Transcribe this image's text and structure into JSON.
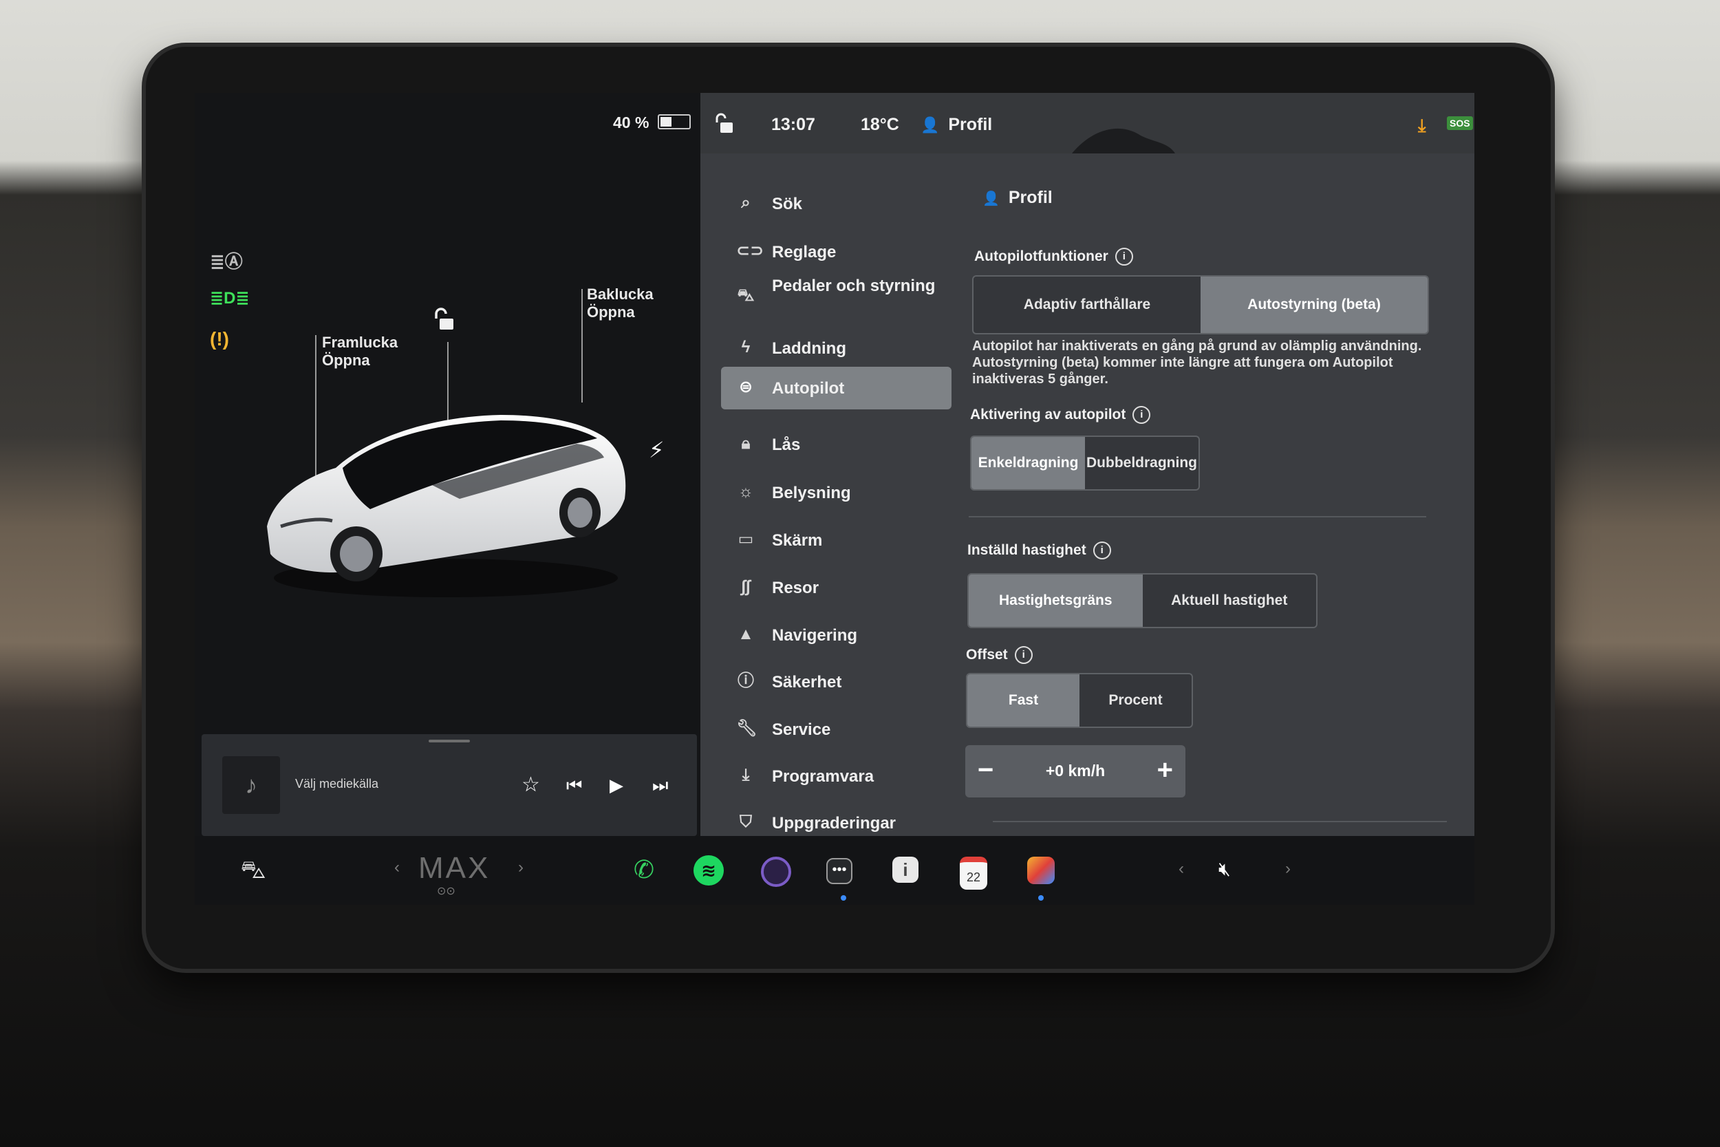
{
  "status": {
    "battery": "40 %",
    "time": "13:07",
    "temperature": "18°C",
    "profile": "Profil"
  },
  "car_view": {
    "frunk_label": "Framlucka",
    "frunk_action": "Öppna",
    "trunk_label": "Baklucka",
    "trunk_action": "Öppna"
  },
  "media": {
    "source_label": "Välj mediekälla"
  },
  "menu": {
    "items": [
      {
        "label": "Sök",
        "icon": "search-icon"
      },
      {
        "label": "Reglage",
        "icon": "toggle-icon"
      },
      {
        "label": "Pedaler och styrning",
        "icon": "car-icon"
      },
      {
        "label": "Laddning",
        "icon": "bolt-icon"
      },
      {
        "label": "Autopilot",
        "icon": "steering-wheel-icon",
        "active": true
      },
      {
        "label": "Lås",
        "icon": "lock-icon"
      },
      {
        "label": "Belysning",
        "icon": "sun-icon"
      },
      {
        "label": "Skärm",
        "icon": "display-icon"
      },
      {
        "label": "Resor",
        "icon": "trips-icon"
      },
      {
        "label": "Navigering",
        "icon": "navigation-icon"
      },
      {
        "label": "Säkerhet",
        "icon": "safety-icon"
      },
      {
        "label": "Service",
        "icon": "wrench-icon"
      },
      {
        "label": "Programvara",
        "icon": "download-icon"
      },
      {
        "label": "Uppgraderingar",
        "icon": "bag-icon"
      }
    ]
  },
  "panel": {
    "profile_title": "Profil",
    "autopilot_features_title": "Autopilotfunktioner",
    "features": [
      "Adaptiv farthållare",
      "Autostyrning (beta)"
    ],
    "features_selected": 1,
    "description": "Autopilot har inaktiverats en gång på grund av olämplig användning. Autostyrning (beta) kommer inte längre att fungera om Autopilot inaktiveras 5 gånger.",
    "activation_title": "Aktivering av autopilot",
    "activation": [
      "Enkeldragning",
      "Dubbeldragning"
    ],
    "activation_selected": 0,
    "set_speed_title": "Inställd hastighet",
    "set_speed": [
      "Hastighetsgräns",
      "Aktuell hastighet"
    ],
    "set_speed_selected": 0,
    "offset_title": "Offset",
    "offset": [
      "Fast",
      "Procent"
    ],
    "offset_selected": 0,
    "offset_value": "+0 km/h"
  },
  "dock": {
    "max_label": "MAX",
    "calendar_day": "22"
  },
  "colors": {
    "accent_blue": "#2f84e8",
    "download_orange": "#f0a020",
    "headlight_green": "#3ee05a",
    "warning_amber": "#f3b532",
    "spotify_green": "#1ed760",
    "phone_green": "#36d060"
  }
}
